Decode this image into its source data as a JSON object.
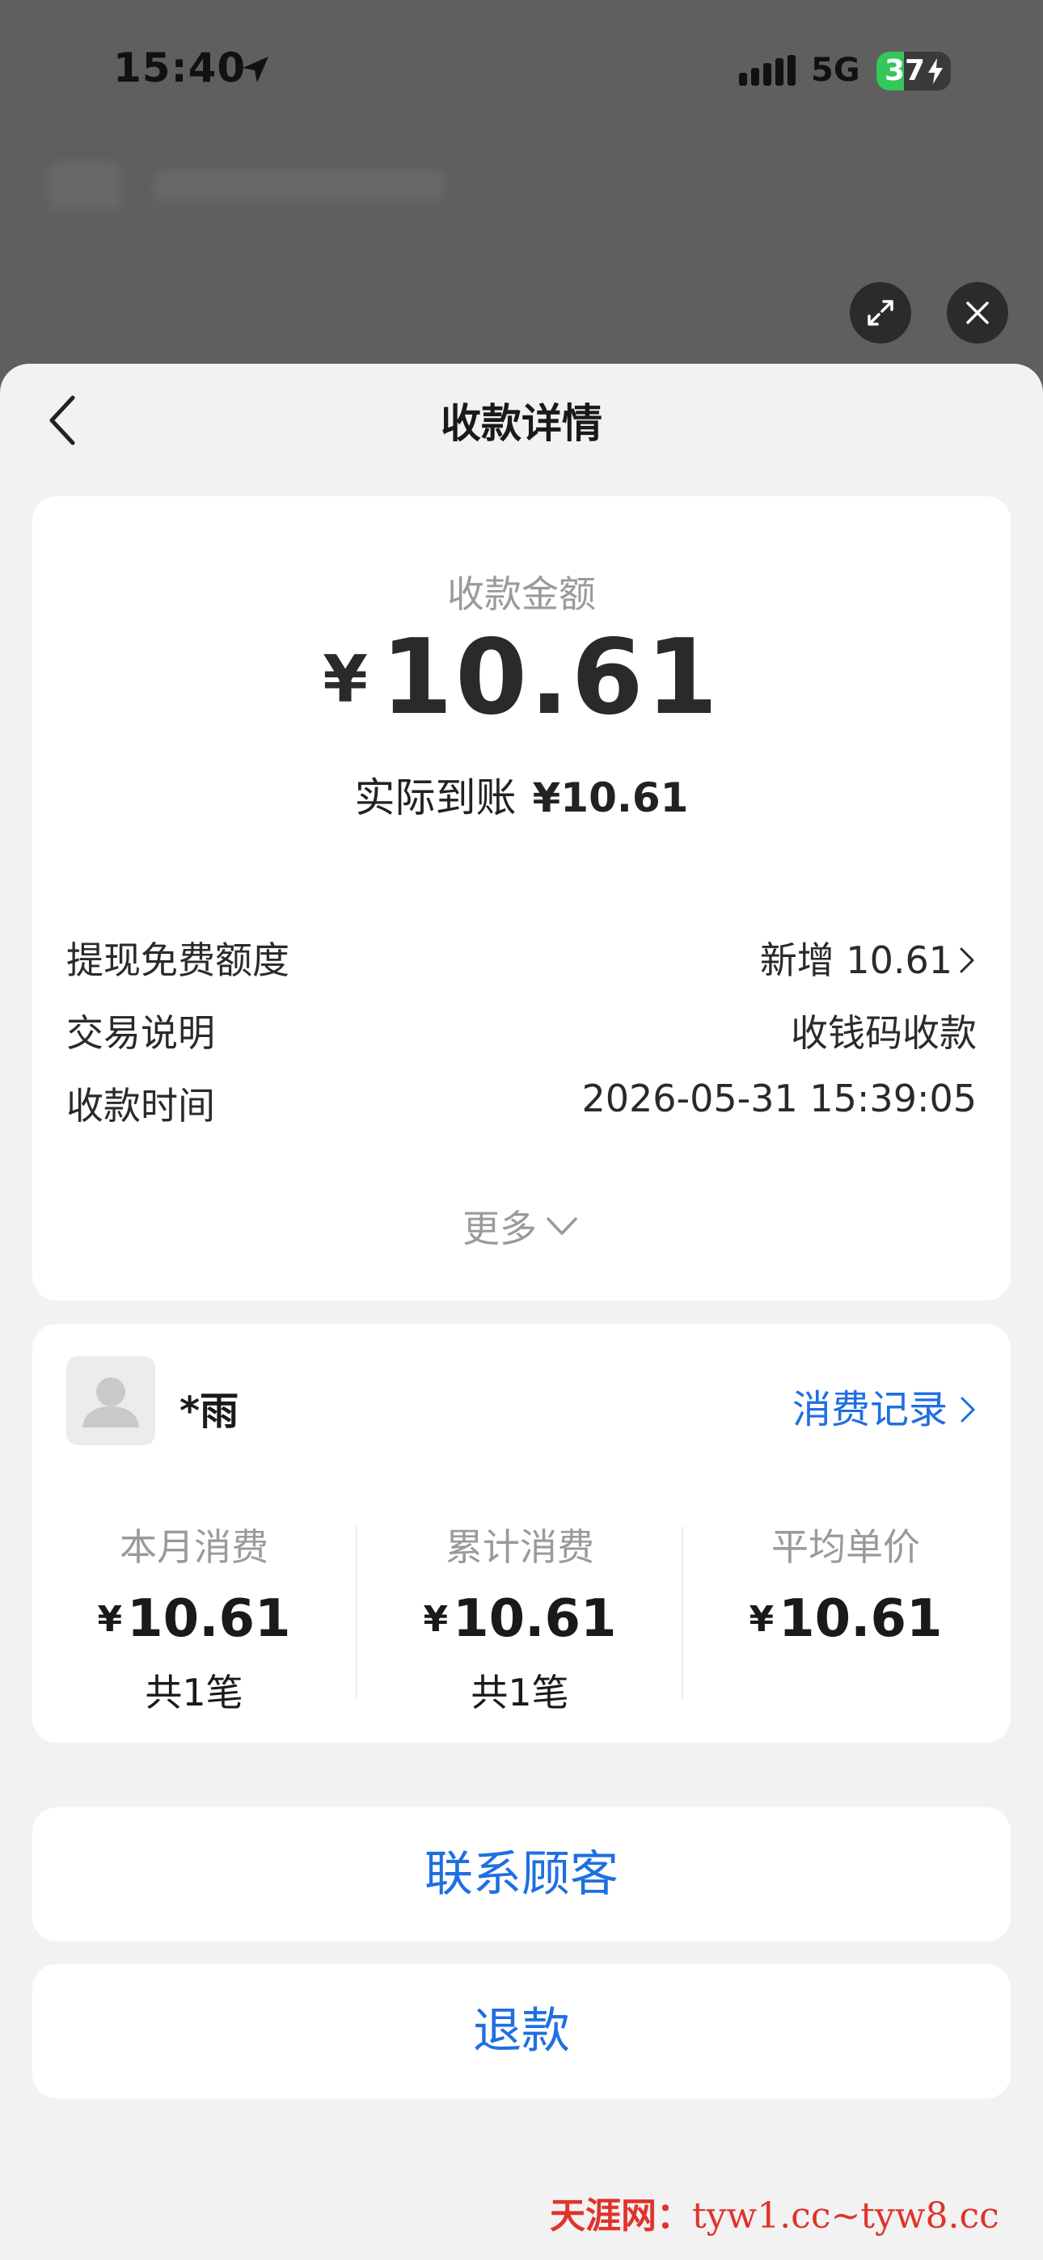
{
  "status_bar": {
    "time": "15:40",
    "network": "5G",
    "battery_percent": "37",
    "battery_level": 0.37,
    "location_icon": "location-arrow-icon",
    "signal_icon": "signal-bars-icon",
    "charging_icon": "bolt-icon"
  },
  "overlay_buttons": {
    "expand_icon": "expand-icon",
    "close_icon": "close-icon"
  },
  "nav": {
    "back_icon": "chevron-left-icon",
    "title": "收款详情"
  },
  "amount_card": {
    "label": "收款金额",
    "currency": "¥",
    "amount": "10.61",
    "actual_label": "实际到账",
    "actual_value": "¥10.61",
    "rows": [
      {
        "key": "提现免费额度",
        "value": "新增 10.61"
      },
      {
        "key": "交易说明",
        "value": "收钱码收款"
      },
      {
        "key": "收款时间",
        "value": "2026-05-31 15:39:05"
      }
    ],
    "more_label": "更多"
  },
  "customer_card": {
    "avatar_icon": "user-placeholder-icon",
    "name": "*雨",
    "record_link": "消费记录",
    "stats": [
      {
        "label": "本月消费",
        "currency": "¥",
        "value": "10.61",
        "count": "共1笔"
      },
      {
        "label": "累计消费",
        "currency": "¥",
        "value": "10.61",
        "count": "共1笔"
      },
      {
        "label": "平均单价",
        "currency": "¥",
        "value": "10.61",
        "count": ""
      }
    ]
  },
  "actions": {
    "contact": "联系顾客",
    "refund": "退款"
  },
  "watermark": {
    "brand": "天涯网：",
    "urls": "tyw1.cc~tyw8.cc"
  },
  "colors": {
    "accent": "#1f6fe0",
    "background_overlay": "#5f5f60",
    "sheet": "#f2f2f2",
    "battery": "#34c759"
  }
}
